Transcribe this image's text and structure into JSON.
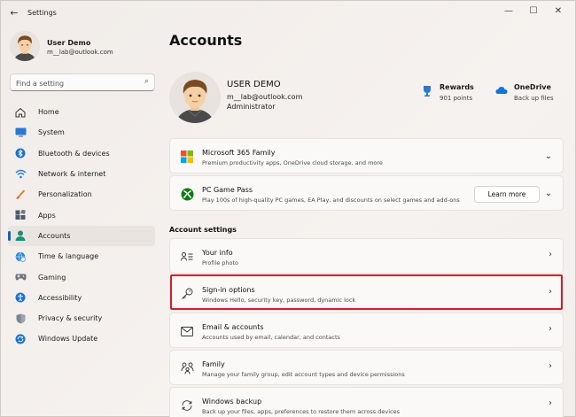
{
  "window": {
    "title": "Settings",
    "controls": [
      "minimize",
      "maximize",
      "close"
    ]
  },
  "sidebar": {
    "profile": {
      "name": "User Demo",
      "email": "m__lab@outlook.com"
    },
    "search": {
      "placeholder": "Find a setting"
    },
    "items": [
      {
        "label": "Home",
        "icon": "home-icon",
        "active": false
      },
      {
        "label": "System",
        "icon": "monitor-icon",
        "active": false
      },
      {
        "label": "Bluetooth & devices",
        "icon": "bluetooth-icon",
        "active": false
      },
      {
        "label": "Network & internet",
        "icon": "wifi-icon",
        "active": false
      },
      {
        "label": "Personalization",
        "icon": "brush-icon",
        "active": false
      },
      {
        "label": "Apps",
        "icon": "apps-icon",
        "active": false
      },
      {
        "label": "Accounts",
        "icon": "person-icon",
        "active": true
      },
      {
        "label": "Time & language",
        "icon": "globe-clock-icon",
        "active": false
      },
      {
        "label": "Gaming",
        "icon": "gamepad-icon",
        "active": false
      },
      {
        "label": "Accessibility",
        "icon": "accessibility-icon",
        "active": false
      },
      {
        "label": "Privacy & security",
        "icon": "shield-icon",
        "active": false
      },
      {
        "label": "Windows Update",
        "icon": "sync-icon",
        "active": false
      }
    ]
  },
  "main": {
    "title": "Accounts",
    "user": {
      "name": "USER DEMO",
      "email": "m__lab@outlook.com",
      "role": "Administrator"
    },
    "rewards": {
      "title": "Rewards",
      "sub": "901 points"
    },
    "onedrive": {
      "title": "OneDrive",
      "sub": "Back up files"
    },
    "promos": [
      {
        "title": "Microsoft 365 Family",
        "sub": "Premium productivity apps, OneDrive cloud storage, and more",
        "icon": "microsoft-logo-icon"
      },
      {
        "title": "PC Game Pass",
        "sub": "Play 100s of high-quality PC games, EA Play, and discounts on select games and add-ons",
        "icon": "xbox-icon",
        "button": "Learn more"
      }
    ],
    "section_title": "Account settings",
    "settings": [
      {
        "title": "Your info",
        "sub": "Profile photo",
        "icon": "person-card-icon"
      },
      {
        "title": "Sign-in options",
        "sub": "Windows Hello, security key, password, dynamic lock",
        "icon": "key-icon",
        "highlighted": true
      },
      {
        "title": "Email & accounts",
        "sub": "Accounts used by email, calendar, and contacts",
        "icon": "mail-icon"
      },
      {
        "title": "Family",
        "sub": "Manage your family group, edit account types and device permissions",
        "icon": "family-icon"
      },
      {
        "title": "Windows backup",
        "sub": "Back up your files, apps, preferences to restore them across devices",
        "icon": "backup-icon"
      }
    ]
  },
  "colors": {
    "accent": "#0067c0",
    "highlight": "#d21f2e"
  }
}
